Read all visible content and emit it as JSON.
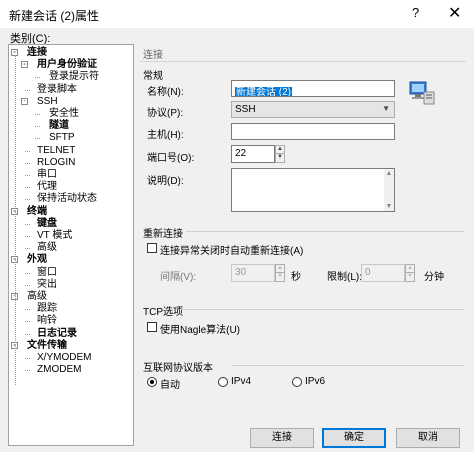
{
  "window": {
    "title": "新建会话 (2)属性",
    "help_glyph": "?",
    "close_glyph": "✕"
  },
  "category_label": "类别(C):",
  "tree": [
    {
      "label": "连接",
      "bold": true,
      "level": 0,
      "toggle": "-"
    },
    {
      "label": "用户身份验证",
      "bold": true,
      "level": 1,
      "toggle": "-"
    },
    {
      "label": "登录提示符",
      "bold": false,
      "level": 2,
      "toggle": ""
    },
    {
      "label": "登录脚本",
      "bold": false,
      "level": 1,
      "toggle": ""
    },
    {
      "label": "SSH",
      "bold": false,
      "level": 1,
      "toggle": "-"
    },
    {
      "label": "安全性",
      "bold": false,
      "level": 2,
      "toggle": ""
    },
    {
      "label": "隧道",
      "bold": true,
      "level": 2,
      "toggle": ""
    },
    {
      "label": "SFTP",
      "bold": false,
      "level": 2,
      "toggle": ""
    },
    {
      "label": "TELNET",
      "bold": false,
      "level": 1,
      "toggle": ""
    },
    {
      "label": "RLOGIN",
      "bold": false,
      "level": 1,
      "toggle": ""
    },
    {
      "label": "串口",
      "bold": false,
      "level": 1,
      "toggle": ""
    },
    {
      "label": "代理",
      "bold": false,
      "level": 1,
      "toggle": ""
    },
    {
      "label": "保持活动状态",
      "bold": false,
      "level": 1,
      "toggle": ""
    },
    {
      "label": "终端",
      "bold": true,
      "level": 0,
      "toggle": "-"
    },
    {
      "label": "键盘",
      "bold": true,
      "level": 1,
      "toggle": ""
    },
    {
      "label": "VT 模式",
      "bold": false,
      "level": 1,
      "toggle": ""
    },
    {
      "label": "高级",
      "bold": false,
      "level": 1,
      "toggle": ""
    },
    {
      "label": "外观",
      "bold": true,
      "level": 0,
      "toggle": "-"
    },
    {
      "label": "窗口",
      "bold": false,
      "level": 1,
      "toggle": ""
    },
    {
      "label": "突出",
      "bold": false,
      "level": 1,
      "toggle": ""
    },
    {
      "label": "高级",
      "bold": false,
      "level": 0,
      "toggle": "-"
    },
    {
      "label": "跟踪",
      "bold": false,
      "level": 1,
      "toggle": ""
    },
    {
      "label": "响铃",
      "bold": false,
      "level": 1,
      "toggle": ""
    },
    {
      "label": "日志记录",
      "bold": true,
      "level": 1,
      "toggle": ""
    },
    {
      "label": "文件传输",
      "bold": true,
      "level": 0,
      "toggle": "-"
    },
    {
      "label": "X/YMODEM",
      "bold": false,
      "level": 1,
      "toggle": ""
    },
    {
      "label": "ZMODEM",
      "bold": false,
      "level": 1,
      "toggle": ""
    }
  ],
  "breadcrumb": "连接",
  "general": {
    "title": "常规",
    "name_label": "名称(N):",
    "name_value": "新建会话 (2)",
    "protocol_label": "协议(P):",
    "protocol_value": "SSH",
    "host_label": "主机(H):",
    "host_value": "",
    "port_label": "端口号(O):",
    "port_value": "22",
    "desc_label": "说明(D):",
    "desc_value": ""
  },
  "reconnect": {
    "title": "重新连接",
    "checkbox_label": "连接异常关闭时自动重新连接(A)",
    "checked": false,
    "interval_label": "间隔(V):",
    "interval_value": "30",
    "interval_unit": "秒",
    "limit_label": "限制(L):",
    "limit_value": "0",
    "limit_unit": "分钟"
  },
  "tcp": {
    "title": "TCP选项",
    "nagle_label": "使用Nagle算法(U)",
    "checked": false
  },
  "ip_version": {
    "title": "互联网协议版本",
    "options": [
      "自动",
      "IPv4",
      "IPv6"
    ],
    "selected": "自动"
  },
  "buttons": {
    "connect": "连接",
    "ok": "确定",
    "cancel": "取消"
  },
  "icons": {
    "session": "computer-network-icon",
    "tree_toggle": "tree-expand-collapse-icon"
  }
}
